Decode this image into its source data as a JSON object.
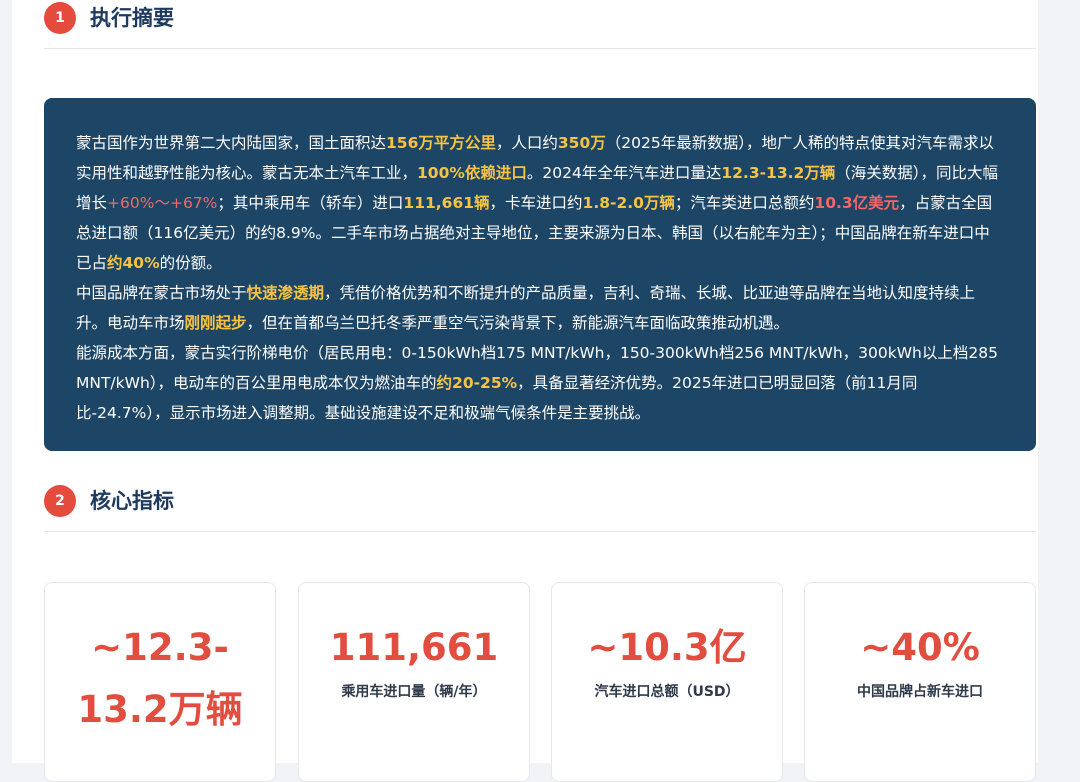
{
  "section1": {
    "number": "1",
    "title": "执行摘要"
  },
  "summary": {
    "p1": {
      "s1": "蒙古国作为世界第二大内陆国家，国土面积达",
      "h1": "156万平方公里",
      "s2": "，人口约",
      "h2": "350万",
      "s3": "（2025年最新数据），地广人稀的特点使其对汽车需求以实用性和越野性能为核心。蒙古无本土汽车工业，",
      "h3": "100%依赖进口",
      "s4": "。2024年全年汽车进口量达",
      "h4": "12.3-13.2万辆",
      "s5": "（海关数据），同比大幅增长",
      "h5": "+60%～+67%",
      "s6": "；其中乘用车（轿车）进口",
      "h6": "111,661辆",
      "s7": "，卡车进口约",
      "h7": "1.8-2.0万辆",
      "s8": "；汽车类进口总额约",
      "h8": "10.3亿美元",
      "s9": "，占蒙古全国总进口额（116亿美元）的约8.9%。二手车市场占据绝对主导地位，主要来源为日本、韩国（以右舵车为主）；中国品牌在新车进口中已占",
      "h9": "约40%",
      "s10": "的份额。"
    },
    "p2": {
      "s1": "中国品牌在蒙古市场处于",
      "h1": "快速渗透期",
      "s2": "，凭借价格优势和不断提升的产品质量，吉利、奇瑞、长城、比亚迪等品牌在当地认知度持续上升。电动车市场",
      "h2": "刚刚起步",
      "s3": "，但在首都乌兰巴托冬季严重空气污染背景下，新能源汽车面临政策推动机遇。"
    },
    "p3": {
      "s1": "能源成本方面，蒙古实行阶梯电价（居民用电：0-150kWh档175 MNT/kWh，150-300kWh档256 MNT/kWh，300kWh以上档285 MNT/kWh），电动车的百公里用电成本仅为燃油车的",
      "h1": "约20-25%",
      "s2": "，具备显著经济优势。2025年进口已明显回落（前11月同比-24.7%），显示市场进入调整期。基础设施建设不足和极端气候条件是主要挑战。"
    }
  },
  "section2": {
    "number": "2",
    "title": "核心指标"
  },
  "metrics": [
    {
      "value": "~12.3-13.2万辆",
      "label": ""
    },
    {
      "value": "111,661",
      "label": "乘用车进口量（辆/年）"
    },
    {
      "value": "~10.3亿",
      "label": "汽车进口总额（USD）"
    },
    {
      "value": "~40%",
      "label": "中国品牌占新车进口"
    }
  ],
  "colors": {
    "accent": "#e54b3c",
    "navy": "#1d4566",
    "highlight_yellow": "#f6c344",
    "highlight_red": "#f0686a"
  }
}
